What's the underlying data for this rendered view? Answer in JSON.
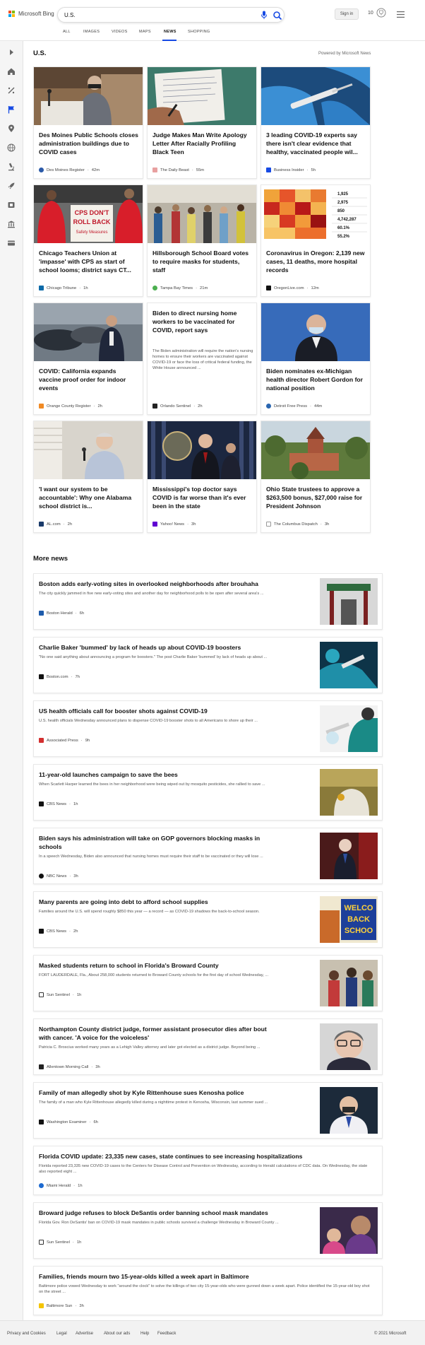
{
  "brand": {
    "name": "Microsoft Bing",
    "colors": [
      "#f25022",
      "#7fba00",
      "#00a4ef",
      "#ffb900"
    ]
  },
  "search": {
    "value": "U.S.",
    "mic_icon": "microphone-icon",
    "search_icon": "search-icon"
  },
  "header": {
    "signin_label": "Sign in",
    "points": "10",
    "reward_icon": "trophy-icon",
    "menu_icon": "hamburger-icon"
  },
  "tabs": [
    {
      "label": "ALL"
    },
    {
      "label": "IMAGES"
    },
    {
      "label": "VIDEOS"
    },
    {
      "label": "MAPS"
    },
    {
      "label": "NEWS",
      "active": true
    },
    {
      "label": "SHOPPING"
    }
  ],
  "rail": [
    "chevron-right-icon",
    "home-icon",
    "scale-icon",
    "flag-icon",
    "pin-icon",
    "globe-icon",
    "microscope-icon",
    "rocket-icon",
    "film-icon",
    "bank-icon",
    "card-icon"
  ],
  "section": {
    "title": "U.S.",
    "powered": "Powered by Microsoft News"
  },
  "cards": [
    {
      "title": "Des Moines Public Schools closes administration buildings due to COVID cases",
      "source": "Des Moines Register",
      "time": "42m"
    },
    {
      "title": "Judge Makes Man Write Apology Letter After Racially Profiling Black Teen",
      "source": "The Daily Beast",
      "time": "55m"
    },
    {
      "title": "3 leading COVID-19 experts say there isn't clear evidence that healthy, vaccinated people wil...",
      "source": "Business Insider",
      "time": "5h"
    },
    {
      "title": "Chicago Teachers Union at 'impasse' with CPS as start of school looms; district says CT...",
      "source": "Chicago Tribune",
      "time": "1h"
    },
    {
      "title": "Hillsborough School Board votes to require masks for students, staff",
      "source": "Tampa Bay Times",
      "time": "21m"
    },
    {
      "title": "Coronavirus in Oregon: 2,139 new cases, 11 deaths, more hospital records",
      "source": "OregonLive.com",
      "time": "12m"
    },
    {
      "title": "COVID: California expands vaccine proof order for indoor events",
      "source": "Orange County Register",
      "time": "2h"
    },
    {
      "title": "Biden to direct nursing home workers to be vaccinated for COVID, report says",
      "snippet": "The Biden administration will require the nation's nursing homes to ensure their workers are vaccinated against COVID-19 or face the loss of critical federal funding, the White House announced ...",
      "source": "Orlando Sentinel",
      "time": "2h"
    },
    {
      "title": "Biden nominates ex-Michigan health director Robert Gordon for national position",
      "source": "Detroit Free Press",
      "time": "44m"
    },
    {
      "title": "'I want our system to be accountable': Why one Alabama school district is...",
      "source": "AL.com",
      "time": "2h"
    },
    {
      "title": "Mississippi's top doctor says COVID is far worse than it's ever been in the state",
      "source": "Yahoo! News",
      "time": "3h"
    },
    {
      "title": "Ohio State trustees to approve a $263,500 bonus, $27,000 raise for President Johnson",
      "source": "The Columbus Dispatch",
      "time": "3h"
    }
  ],
  "oregon_stats": [
    "1,925",
    "2,975",
    "850",
    "4,742,287",
    "60.1%",
    "55.2%"
  ],
  "cps_sign": [
    "CPS DON'T",
    "ROLL BACK",
    "Safety Measures"
  ],
  "more_news": {
    "title": "More news",
    "items": [
      {
        "title": "Boston adds early-voting sites in overlooked neighborhoods after brouhaha",
        "snippet": "The city quickly jammed in five new early-voting sites and another day for neighborhood polls to be open after several area's ...",
        "source": "Boston Herald",
        "time": "6h"
      },
      {
        "title": "Charlie Baker 'bummed' by lack of heads up about COVID-19 boosters",
        "snippet": "\"No one said anything about announcing a program for boosters.\" The post Charlie Baker 'bummed' by lack of heads up about ...",
        "source": "Boston.com",
        "time": "7h"
      },
      {
        "title": "US health officials call for booster shots against COVID-19",
        "snippet": "U.S. health officials Wednesday announced plans to dispense COVID-19 booster shots to all Americans to shore up their ...",
        "source": "Associated Press",
        "time": "9h"
      },
      {
        "title": "11-year-old launches campaign to save the bees",
        "snippet": "When Scarlett Harper learned the bees in her neighborhood were being wiped out by mosquito pesticides, she rallied to save ...",
        "source": "CBS News",
        "time": "1h"
      },
      {
        "title": "Biden says his administration will take on GOP governors blocking masks in schools",
        "snippet": "In a speech Wednesday, Biden also announced that nursing homes must require their staff to be vaccinated or they will lose ...",
        "source": "NBC News",
        "time": "3h"
      },
      {
        "title": "Many parents are going into debt to afford school supplies",
        "snippet": "Families around the U.S. will spend roughly $850 this year — a record — as COVID-19 shadows the back-to-school season.",
        "source": "CBS News",
        "time": "2h"
      },
      {
        "title": "Masked students return to school in Florida's Broward County",
        "snippet": "FORT LAUDERDALE, Fla., About 258,000 students returned to Broward County schools for the first day of school Wednesday, ...",
        "source": "Sun Sentinel",
        "time": "1h"
      },
      {
        "title": "Northampton County district judge, former assistant prosecutor dies after bout with cancer. 'A voice for the voiceless'",
        "snippet": "Patricia C. Broscius worked many years as a Lehigh Valley attorney and later got elected as a district judge. Beyond being ...",
        "source": "Allentown Morning Call",
        "time": "3h"
      },
      {
        "title": "Family of man allegedly shot by Kyle Rittenhouse sues Kenosha police",
        "snippet": "The family of a man who Kyle Rittenhouse allegedly killed during a nighttime protest in Kenosha, Wisconsin, last summer sued ...",
        "source": "Washington Examiner",
        "time": "6h"
      },
      {
        "title": "Florida COVID update: 23,335 new cases, state continues to see increasing hospitalizations",
        "snippet": "Florida reported 23,335 new COVID-19 cases to the Centers for Disease Control and Prevention on Wednesday, according to Herald calculations of CDC data. On Wednesday, the state also reported eight ...",
        "source": "Miami Herald",
        "time": "1h"
      },
      {
        "title": "Broward judge refuses to block DeSantis order banning school mask mandates",
        "snippet": "Florida Gov. Ron DeSantis' ban on COVID-19 mask mandates in public schools survived a challenge Wednesday in Broward County ...",
        "source": "Sun Sentinel",
        "time": "1h"
      },
      {
        "title": "Families, friends mourn two 15-year-olds killed a week apart in Baltimore",
        "snippet": "Baltimore police vowed Wednesday to work \"around the clock\" to solve the killings of two city 15-year-olds who were gunned down a week apart. Police identified the 15-year-old boy shot on the street ...",
        "source": "Baltimore Sun",
        "time": "3h"
      }
    ]
  },
  "banner_text": [
    "WELCO",
    "BACK",
    "SCHOO"
  ],
  "footer": {
    "links": [
      "Privacy and Cookies",
      "Legal",
      "Advertise",
      "About our ads",
      "Help",
      "Feedback"
    ],
    "copyright": "© 2021 Microsoft"
  }
}
